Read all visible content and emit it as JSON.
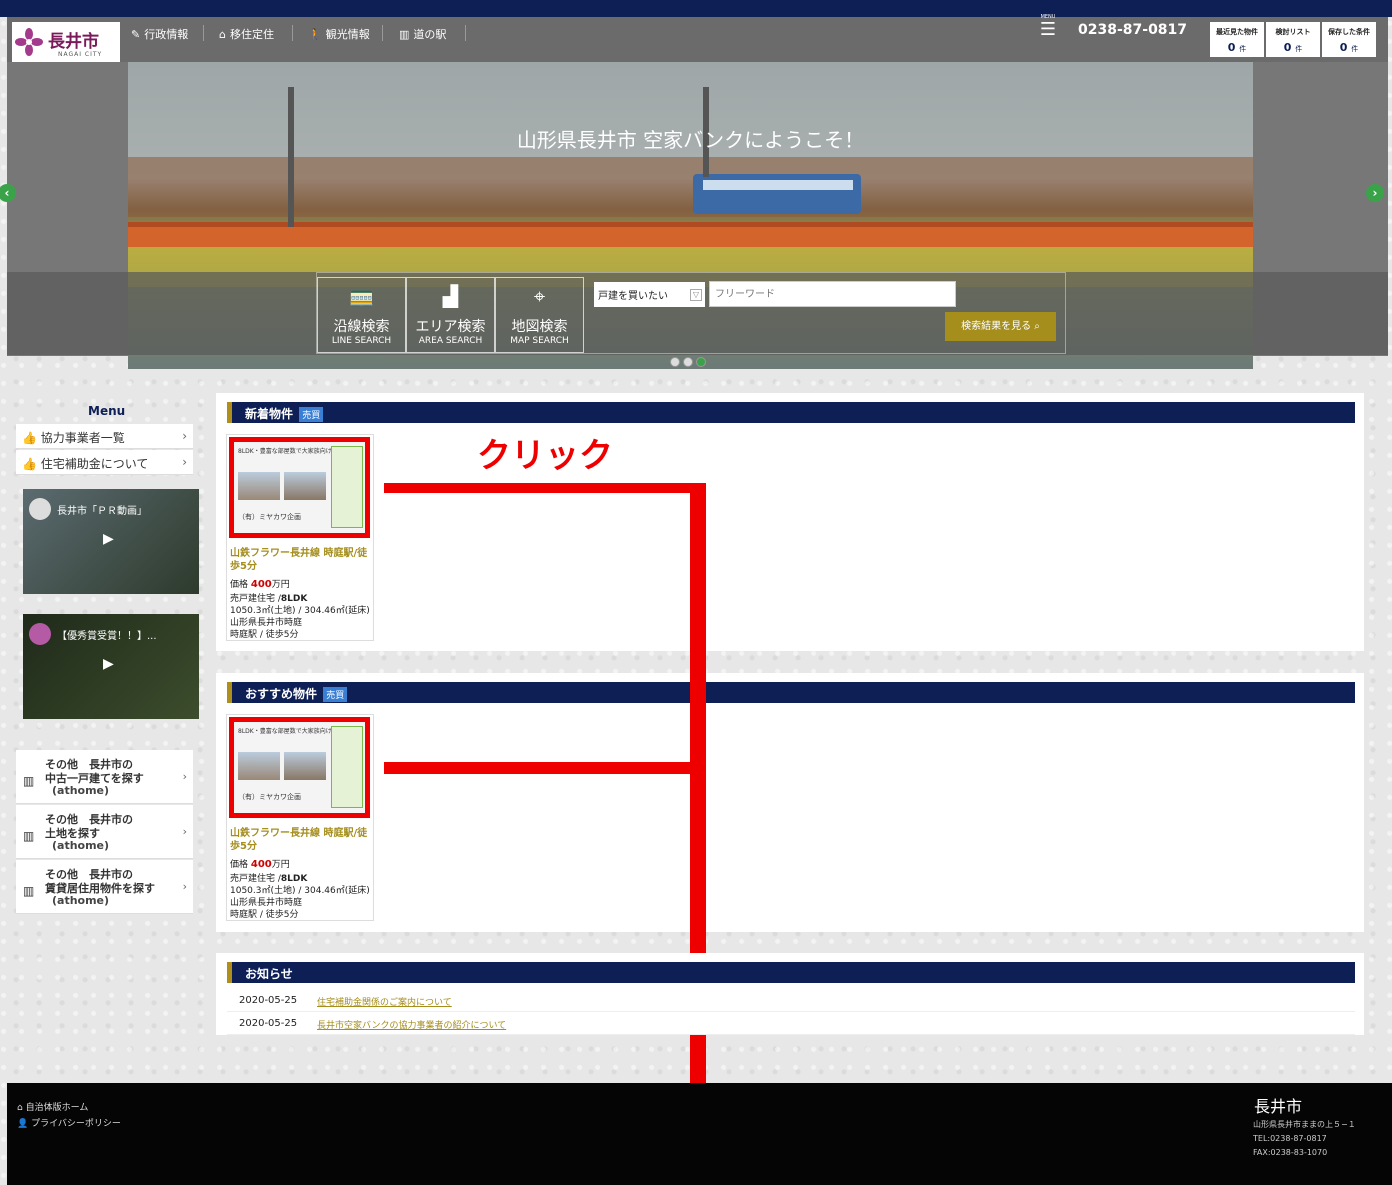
{
  "logo": {
    "jp": "長井市",
    "en": "NAGAI CITY"
  },
  "nav": [
    {
      "label": "行政情報",
      "icon": "pencil-icon"
    },
    {
      "label": "移住定住",
      "icon": "home-icon"
    },
    {
      "label": "観光情報",
      "icon": "walking-person-icon"
    },
    {
      "label": "道の駅",
      "icon": "building-icon"
    }
  ],
  "menu_button": {
    "label": "MENU"
  },
  "phone": "0238-87-0817",
  "counters": [
    {
      "label": "最近見た物件",
      "value": "0",
      "unit": "件"
    },
    {
      "label": "検討リスト",
      "value": "0",
      "unit": "件"
    },
    {
      "label": "保存した条件",
      "value": "0",
      "unit": "件"
    }
  ],
  "hero": {
    "title": "山形県長井市 空家バンクにようこそ！"
  },
  "search": {
    "tabs": [
      {
        "jp": "沿線検索",
        "en": "LINE SEARCH",
        "icon": "train-icon"
      },
      {
        "jp": "エリア検索",
        "en": "AREA SEARCH",
        "icon": "area-icon"
      },
      {
        "jp": "地図検索",
        "en": "MAP SEARCH",
        "icon": "map-icon"
      }
    ],
    "select_value": "戸建を買いたい",
    "freeword_placeholder": "フリーワード",
    "result_button": "検索結果を見る"
  },
  "sidebar": {
    "title": "Menu",
    "items": [
      "協力事業者一覧",
      "住宅補助金について"
    ],
    "videos": [
      {
        "title": "長井市「ＰＲ動画」"
      },
      {
        "title": "【優秀賞受賞！！】..."
      }
    ],
    "athome": [
      {
        "l1": "その他　長井市の",
        "l2": "中古一戸建てを探す",
        "l3": "(athome)"
      },
      {
        "l1": "その他　長井市の",
        "l2": "土地を探す",
        "l3": "(athome)"
      },
      {
        "l1": "その他　長井市の",
        "l2": "賃貸居住用物件を探す",
        "l3": "(athome)"
      }
    ]
  },
  "sections": {
    "new": {
      "title": "新着物件",
      "tag": "売買"
    },
    "recommended": {
      "title": "おすすめ物件",
      "tag": "売買"
    },
    "news": {
      "title": "お知らせ"
    }
  },
  "property": {
    "flyer_title": "8LDK・豊富な部屋数で大家族向け",
    "flyer_company": "（有）ミヤカワ企画",
    "title": "山鉄フラワー長井線 時庭駅/徒歩5分",
    "price_label": "価格",
    "price": "400",
    "price_unit": "万円",
    "type": "売戸建住宅 /",
    "layout": "8LDK",
    "area": "1050.3㎡(土地) / 304.46㎡(延床)",
    "address": "山形県長井市時庭",
    "access": "時庭駅 / 徒歩5分"
  },
  "annotation": {
    "click_label": "クリック"
  },
  "news": [
    {
      "date": "2020-05-25",
      "text": "住宅補助金関係のご案内について"
    },
    {
      "date": "2020-05-25",
      "text": "長井市空家バンクの協力事業者の紹介について"
    }
  ],
  "footer": {
    "links": [
      "自治体版ホーム",
      "プライバシーポリシー"
    ],
    "city": "長井市",
    "address": "山形県長井市ままの上５−１",
    "tel": "TEL:0238-87-0817",
    "fax": "FAX:0238-83-1070"
  },
  "colors": {
    "navy": "#0e1f56",
    "gold": "#a58e1c",
    "green": "#3aa34a",
    "red_annotation": "#ee0000"
  }
}
